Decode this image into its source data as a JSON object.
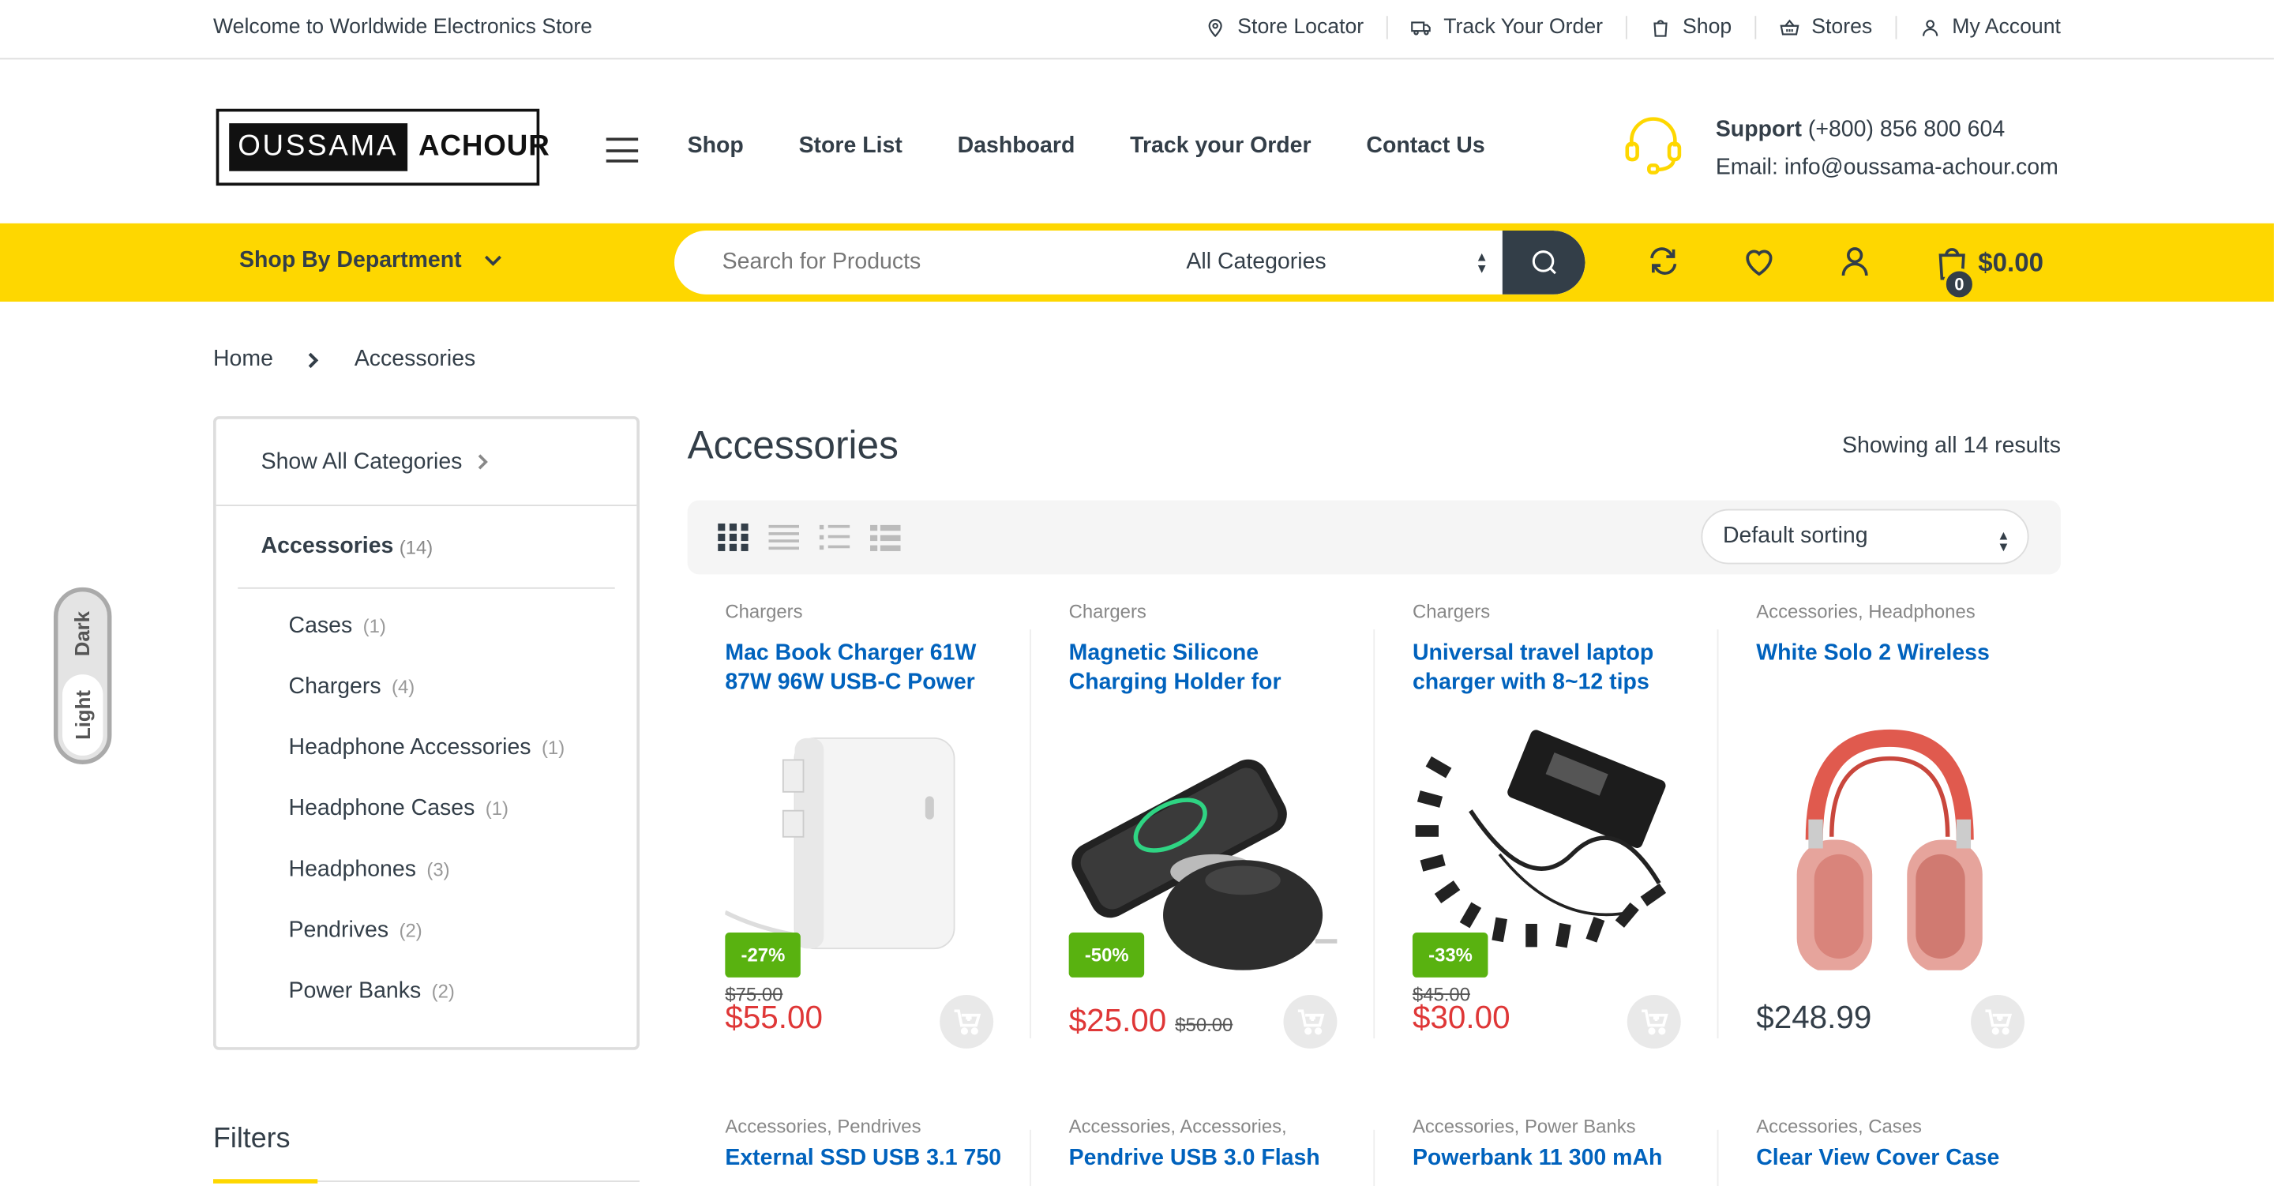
{
  "topbar": {
    "welcome": "Welcome to Worldwide Electronics Store",
    "links": [
      {
        "label": "Store Locator",
        "icon": "map-pin-icon"
      },
      {
        "label": "Track Your Order",
        "icon": "truck-icon"
      },
      {
        "label": "Shop",
        "icon": "shopping-bag-icon"
      },
      {
        "label": "Stores",
        "icon": "basket-icon"
      },
      {
        "label": "My Account",
        "icon": "user-icon"
      }
    ]
  },
  "header": {
    "logo_left": "OUSSAMA",
    "logo_right": "ACHOUR",
    "nav": [
      "Shop",
      "Store List",
      "Dashboard",
      "Track your Order",
      "Contact Us"
    ],
    "support_label": "Support",
    "support_phone": "(+800) 856 800 604",
    "support_email": "Email: info@oussama-achour.com"
  },
  "navbar": {
    "department": "Shop By Department",
    "search_placeholder": "Search for Products",
    "category": "All Categories",
    "cart_count": "0",
    "cart_total": "$0.00",
    "accent": "#fed700"
  },
  "breadcrumb": [
    "Home",
    "Accessories"
  ],
  "theme_toggle": {
    "dark": "Dark",
    "light": "Light"
  },
  "sidebar": {
    "show_all": "Show All Categories",
    "heading": "Accessories",
    "heading_count": "(14)",
    "categories": [
      {
        "name": "Cases",
        "count": "(1)"
      },
      {
        "name": "Chargers",
        "count": "(4)"
      },
      {
        "name": "Headphone Accessories",
        "count": "(1)"
      },
      {
        "name": "Headphone Cases",
        "count": "(1)"
      },
      {
        "name": "Headphones",
        "count": "(3)"
      },
      {
        "name": "Pendrives",
        "count": "(2)"
      },
      {
        "name": "Power Banks",
        "count": "(2)"
      }
    ],
    "filters_title": "Filters"
  },
  "main": {
    "title": "Accessories",
    "results": "Showing all 14 results",
    "sorting": "Default sorting",
    "products": [
      {
        "cats": "Chargers",
        "name": "Mac Book Charger 61W 87W 96W USB-C Power",
        "badge": "-27%",
        "old": "$75.00",
        "price": "$55.00"
      },
      {
        "cats": "Chargers",
        "name": "Magnetic Silicone Charging Holder for",
        "badge": "-50%",
        "old": "$50.00",
        "price": "$25.00"
      },
      {
        "cats": "Chargers",
        "name": "Universal travel laptop charger with 8~12 tips",
        "badge": "-33%",
        "old": "$45.00",
        "price": "$30.00"
      },
      {
        "cats_a": "Accessories",
        "cats_b": "Headphones",
        "name": "White Solo 2 Wireless",
        "price": "$248.99"
      }
    ],
    "products_row2": [
      {
        "cats_a": "Accessories",
        "cats_b": "Pendrives",
        "name": "External SSD USB 3.1 750"
      },
      {
        "cats_a": "Accessories",
        "cats_b": "Accessories",
        "name": "Pendrive USB 3.0 Flash"
      },
      {
        "cats_a": "Accessories",
        "cats_b": "Power Banks",
        "name": "Powerbank 11 300 mAh"
      },
      {
        "cats_a": "Accessories",
        "cats_b": "Cases",
        "name": "Clear View Cover Case"
      }
    ]
  }
}
